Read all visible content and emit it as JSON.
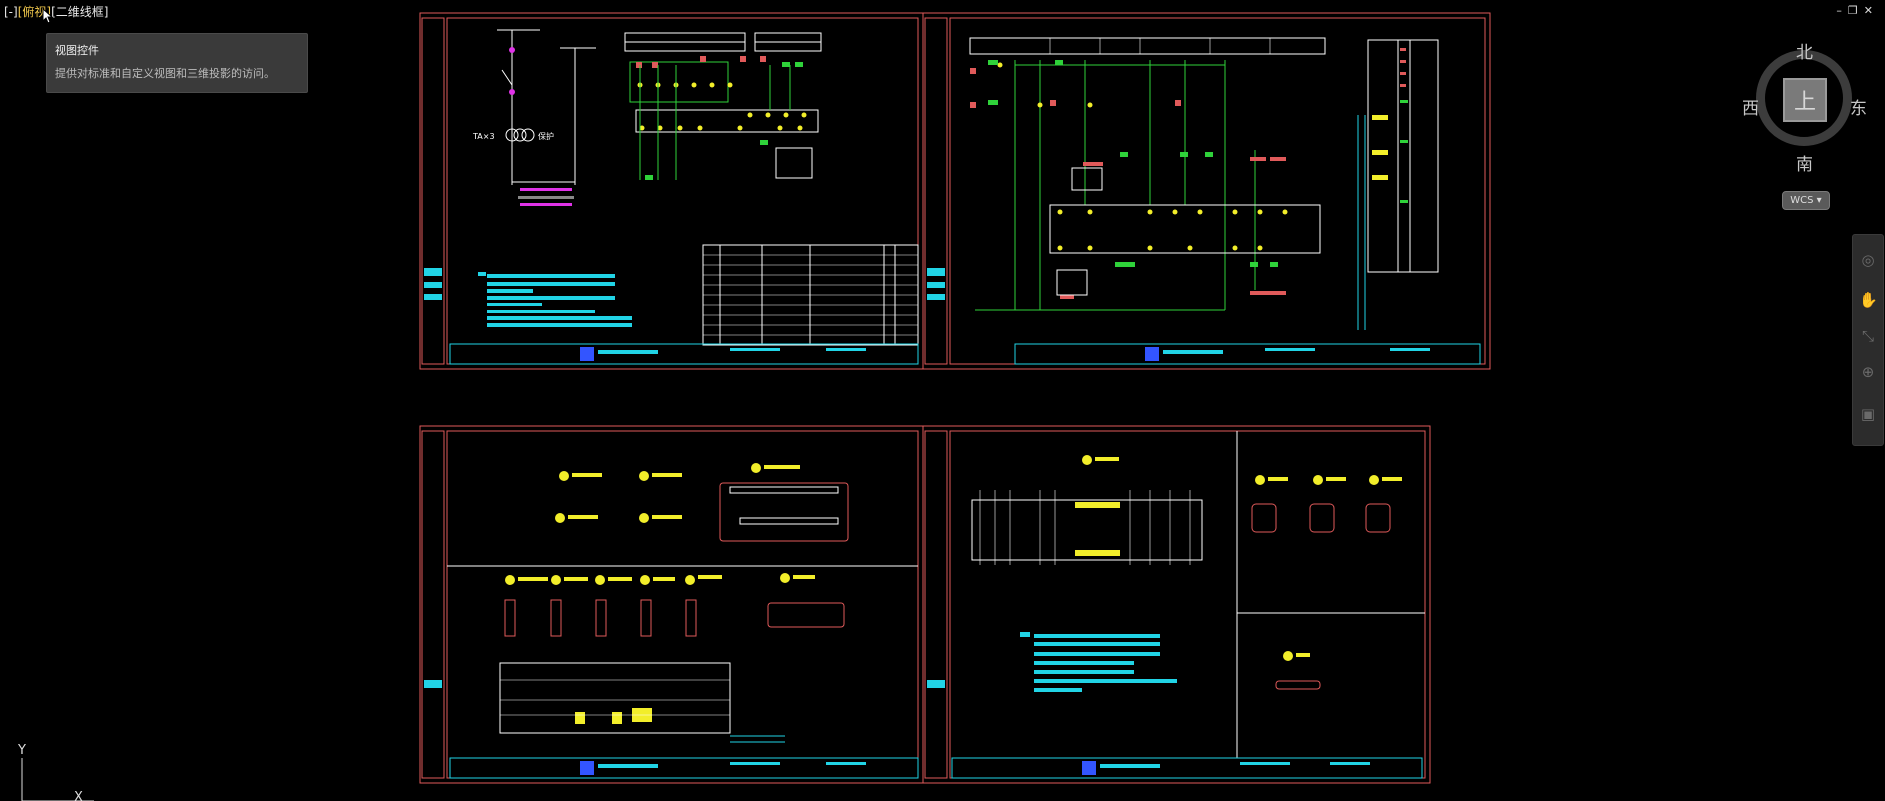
{
  "viewport": {
    "prefix": "[-]",
    "view": "[俯视]",
    "style": "[二维线框]"
  },
  "tooltip": {
    "title": "视图控件",
    "description": "提供对标准和自定义视图和三维投影的访问。"
  },
  "window_controls": [
    "–",
    "❐",
    "✕"
  ],
  "viewcube": {
    "face": "上",
    "north": "北",
    "south": "南",
    "west": "西",
    "east": "东"
  },
  "wcs": "WCS",
  "navbar_icons": [
    "steering-wheel-icon",
    "pan-icon",
    "zoom-icon",
    "orbit-icon",
    "showmotion-icon"
  ],
  "ucs": {
    "y_label": "Y",
    "x_label": "X"
  },
  "colors": {
    "background": "#000000",
    "frame": "#e05a5a",
    "cyan": "#21d4e6",
    "green": "#2fd23a",
    "yellow": "#f2ee2a",
    "magenta": "#e033e8",
    "white": "#f0f0f0"
  }
}
